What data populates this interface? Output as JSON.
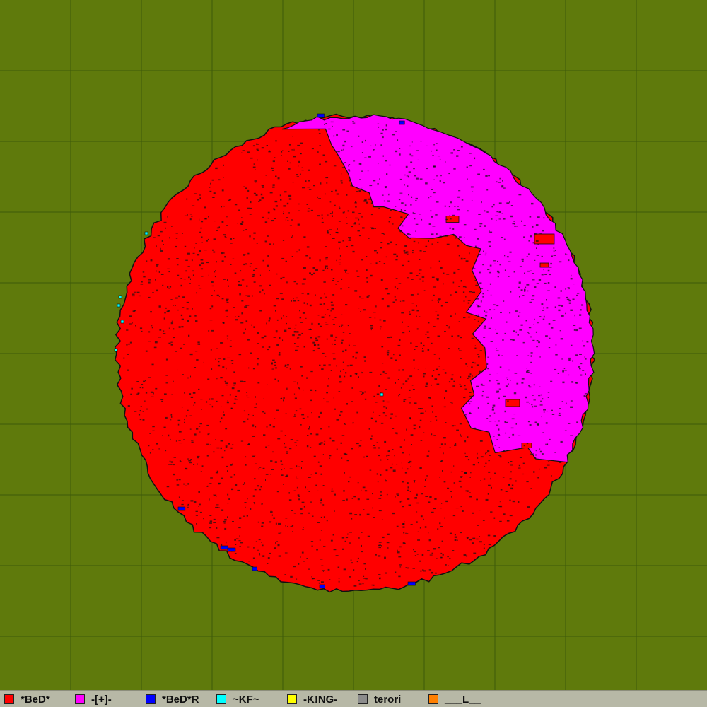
{
  "map": {
    "background_color": "#5f7a0c",
    "grid_color": "#3d5a0a",
    "outline_color": "#111111",
    "territories": [
      {
        "team": "*BeD*",
        "color": "#ff0000",
        "region": "main-body"
      },
      {
        "team": "-[+]-",
        "color": "#ff00ff",
        "region": "north-east-crescent"
      },
      {
        "team": "*BeD*R",
        "color": "#0000ff",
        "region": "scattered-edge-cells"
      },
      {
        "team": "~KF~",
        "color": "#00ffff",
        "region": "scattered-west-edge-cells"
      }
    ]
  },
  "legend": {
    "items": [
      {
        "label": "*BeD*",
        "color": "#ff0000",
        "icon": "red-square"
      },
      {
        "label": "-[+]-",
        "color": "#ff00ff",
        "icon": "magenta-square"
      },
      {
        "label": "*BeD*R",
        "color": "#0000ff",
        "icon": "blue-square"
      },
      {
        "label": "~KF~",
        "color": "#00ffff",
        "icon": "cyan-square"
      },
      {
        "label": "-K!NG-",
        "color": "#ffff00",
        "icon": "yellow-square"
      },
      {
        "label": "terori",
        "color": "#8c8c8c",
        "icon": "gray-square"
      },
      {
        "label": "___L__",
        "color": "#ff7f00",
        "icon": "orange-square"
      }
    ]
  }
}
